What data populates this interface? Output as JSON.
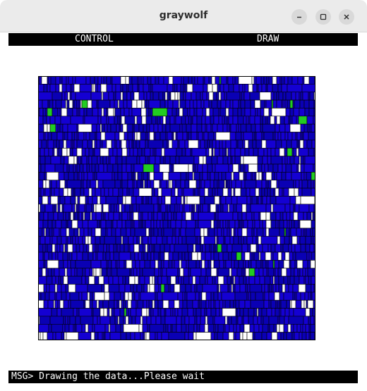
{
  "window": {
    "title": "graywolf"
  },
  "menubar": {
    "control_label": "CONTROL",
    "draw_label": "DRAW"
  },
  "status": {
    "prefix": "MSG>",
    "message": "Drawing the data...Please wait"
  },
  "colors": {
    "cell_fill": "#1400d2",
    "cell_fill_alt": "#0a00b4",
    "cell_border": "#000000",
    "empty_fill": "#ffffff",
    "highlight_fill": "#22cc22",
    "bar_bg": "#000000",
    "bar_text": "#ffffff"
  },
  "icons": {
    "minimize": "minimize-icon",
    "maximize": "maximize-icon",
    "close": "close-icon"
  }
}
